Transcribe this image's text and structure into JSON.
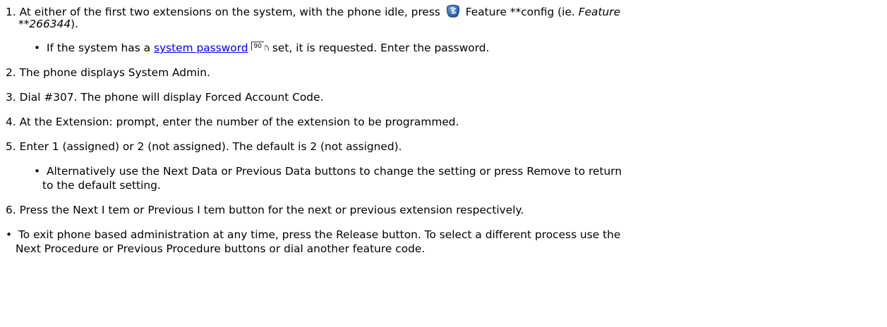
{
  "steps": {
    "s1": {
      "num": "1.",
      "pre": "At either of the first two extensions on the system, with the phone idle, press ",
      "post": " Feature **config (ie. ",
      "italic1": "Feature",
      "italic2": "**266344",
      "tail": ").",
      "icon": "feature-key-icon"
    },
    "s1_bullet": {
      "marker": "•",
      "pre": "If the system has a ",
      "link": "system password",
      "pageref": "90",
      "post": " set, it is requested. Enter the password."
    },
    "s2": {
      "num": "2.",
      "text": "The phone displays System Admin."
    },
    "s3": {
      "num": "3.",
      "text": "Dial #307. The phone will display Forced Account Code."
    },
    "s4": {
      "num": "4.",
      "text": "At the Extension: prompt, enter the number of the extension to be programmed."
    },
    "s5": {
      "num": "5.",
      "text": "Enter 1 (assigned) or 2 (not assigned). The default is 2 (not assigned)."
    },
    "s5_bullet": {
      "marker": "•",
      "line1": "Alternatively use the Next Data or Previous Data buttons to change the setting or press Remove to return",
      "line2": "to the default setting."
    },
    "s6": {
      "num": "6.",
      "text": "Press the Next I tem or Previous I tem button for the next or previous extension respectively."
    }
  },
  "note": {
    "marker": "•",
    "line1": "To exit phone based administration at any time, press the Release button. To select a different process use the",
    "line2": "Next Procedure or Previous Procedure buttons or dial another feature code."
  },
  "colors": {
    "link": "#0000ee",
    "icon_blue": "#1c5fa8"
  }
}
